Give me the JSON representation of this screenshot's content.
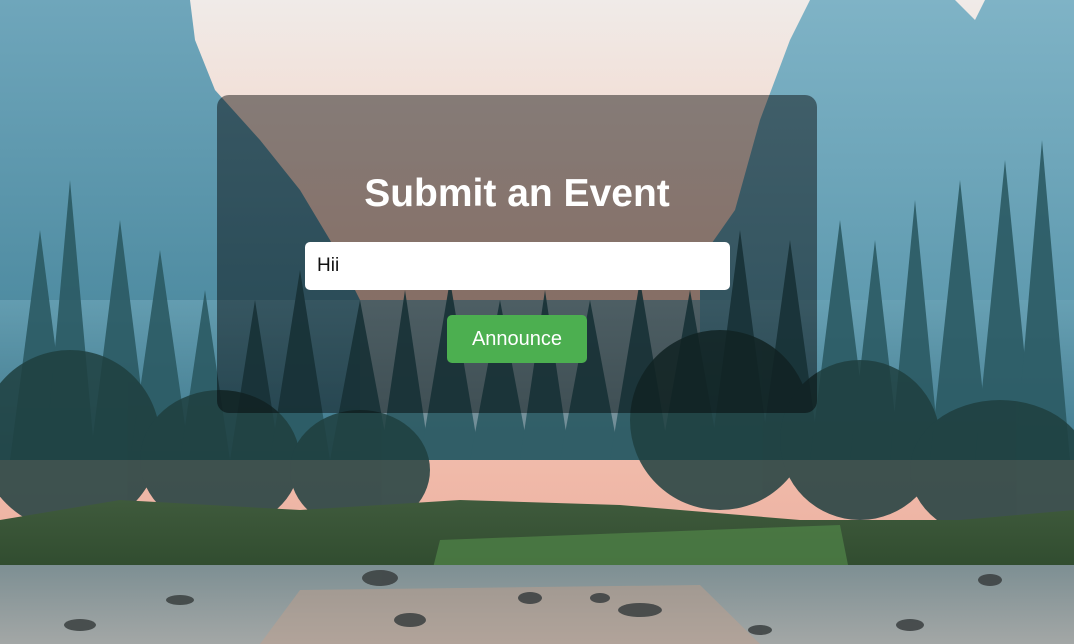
{
  "form": {
    "title": "Submit an Event",
    "input_value": "Hii",
    "input_placeholder": "",
    "button_label": "Announce"
  },
  "colors": {
    "button": "#4caf50",
    "card_overlay": "rgba(0,0,0,0.45)",
    "sky": "#f2c9b6",
    "mountain": "#5f93a6",
    "forest": "#2f5d66",
    "river": "#6f8a90"
  }
}
